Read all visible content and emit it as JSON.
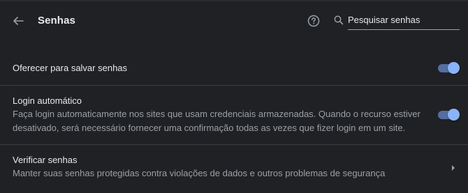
{
  "header": {
    "title": "Senhas",
    "search_placeholder": "Pesquisar senhas"
  },
  "settings": {
    "offer_save": {
      "label": "Oferecer para salvar senhas",
      "enabled": true
    },
    "auto_login": {
      "label": "Login automático",
      "description": "Faça login automaticamente nos sites que usam credenciais armazenadas. Quando o recurso estiver desativado, será necessário fornecer uma confirmação todas as vezes que fizer login em um site.",
      "enabled": true
    },
    "check_passwords": {
      "label": "Verificar senhas",
      "description": "Manter suas senhas protegidas contra violações de dados e outros problemas de segurança"
    }
  },
  "colors": {
    "background": "#202124",
    "accent": "#8ab4f8",
    "text_primary": "#e8eaed",
    "text_secondary": "#9aa0a6"
  },
  "icons": {
    "back": "arrow-back-icon",
    "help": "help-circle-icon",
    "search": "search-icon",
    "chevron": "chevron-right-icon"
  }
}
